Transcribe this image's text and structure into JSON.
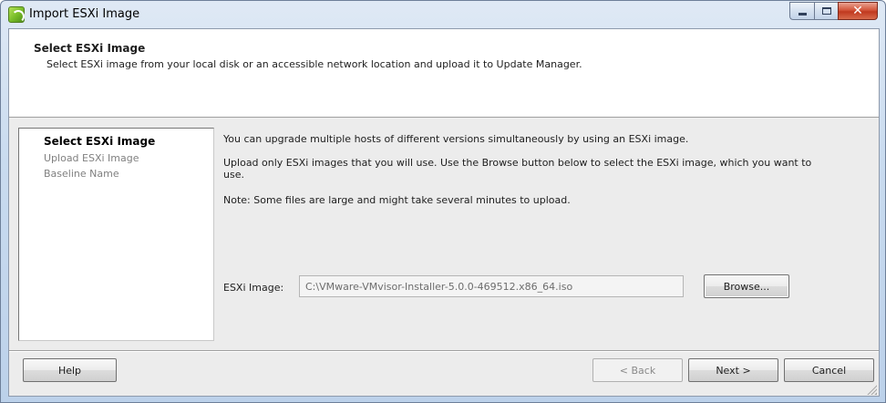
{
  "window": {
    "title": "Import ESXi Image",
    "icon": "import-image-icon",
    "controls": {
      "minimize": "minimize-icon",
      "maximize": "maximize-icon",
      "close": "close-icon",
      "close_glyph": "✕"
    }
  },
  "header": {
    "title": "Select ESXi Image",
    "subtitle": "Select ESXi image from your local disk or an accessible network location and upload it to Update Manager."
  },
  "steps": [
    {
      "label": "Select ESXi Image",
      "active": true
    },
    {
      "label": "Upload ESXi Image",
      "active": false
    },
    {
      "label": "Baseline Name",
      "active": false
    }
  ],
  "content": {
    "para1": "You can upgrade multiple hosts of different versions simultaneously by using an ESXi image.",
    "para2_line1": "Upload only ESXi images that you will use. Use the Browse button below to select the ESXi image, which you want to",
    "para2_line2": "use.",
    "para3": "Note: Some files are large and might take several minutes to upload.",
    "esxi_image_label": "ESXi Image:",
    "esxi_image_value": "C:\\VMware-VMvisor-Installer-5.0.0-469512.x86_64.iso",
    "browse_label": "Browse..."
  },
  "footer": {
    "help_label": "Help",
    "back_label": "< Back",
    "next_label": "Next >",
    "cancel_label": "Cancel"
  },
  "colors": {
    "titlebar_gradient_top": "#dfe9f5",
    "close_button": "#c0391f",
    "client_background": "#ececec",
    "disabled_text": "#808080"
  }
}
